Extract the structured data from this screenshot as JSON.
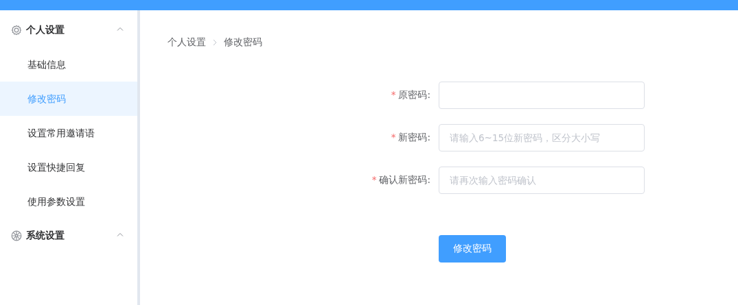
{
  "sidebar": {
    "groups": [
      {
        "title": "个人设置",
        "expanded": true,
        "items": [
          {
            "label": "基础信息",
            "selected": false
          },
          {
            "label": "修改密码",
            "selected": true
          },
          {
            "label": "设置常用邀请语",
            "selected": false
          },
          {
            "label": "设置快捷回复",
            "selected": false
          },
          {
            "label": "使用参数设置",
            "selected": false
          }
        ]
      },
      {
        "title": "系统设置",
        "expanded": true
      }
    ]
  },
  "breadcrumb": [
    "个人设置",
    "修改密码"
  ],
  "form": {
    "fields": [
      {
        "label": "原密码:",
        "required": true,
        "mark": "*"
      },
      {
        "label": "新密码:",
        "required": true,
        "mark": "*",
        "placeholder": "请输入6~15位新密码，区分大小写"
      },
      {
        "label": "确认新密码:",
        "required": true,
        "mark": "*",
        "placeholder": "请再次输入密码确认"
      }
    ],
    "submit": "修改密码"
  }
}
